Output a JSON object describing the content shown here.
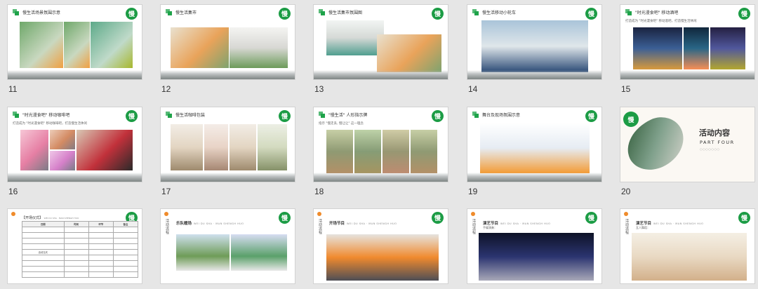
{
  "slides": [
    {
      "number": "11",
      "title": "慢生活场景氛围示意",
      "logo": "慢"
    },
    {
      "number": "12",
      "title": "慢生活集市",
      "logo": "慢"
    },
    {
      "number": "13",
      "title": "慢生活集市氛围图",
      "logo": "慢"
    },
    {
      "number": "14",
      "title": "慢生活移动小轮车",
      "logo": "慢"
    },
    {
      "number": "15",
      "title": "\"时光漫食吧\" 移动酒吧",
      "subtitle": "打造成为 \"时光漫食吧\" 移动酒吧，打造慢生活休闲",
      "logo": "慢"
    },
    {
      "number": "16",
      "title": "\"时光漫食吧\" 移动咖啡吧",
      "subtitle": "打造成为 \"时光漫食吧\" 移动咖啡吧，打造慢生活休闲",
      "logo": "慢"
    },
    {
      "number": "17",
      "title": "慢生活咖啡包装",
      "logo": "慢"
    },
    {
      "number": "18",
      "title": "\"慢生活\" 人形指示牌",
      "subtitle": "指示 \"慢走丢, 慢让让\" 这一理念",
      "logo": "慢"
    },
    {
      "number": "19",
      "title": "舞台及现场氛围示意",
      "logo": "慢"
    },
    {
      "number": "20",
      "part_title": "活动内容",
      "part_label": "PART FOUR",
      "part_dots": "○○○○○○○",
      "logo": "慢"
    }
  ],
  "table_slide": {
    "title": "【开场仪式】",
    "title_en": "WEI DU SHA · MAN SHENGH HUO",
    "headers": [
      "日期",
      "时间",
      "环节",
      "备注"
    ],
    "rows": [
      [
        "",
        "",
        "",
        ""
      ],
      [
        "",
        "",
        "",
        ""
      ],
      [
        "",
        "",
        "",
        ""
      ],
      [
        "",
        "",
        "",
        ""
      ],
      [
        "活动当天",
        "",
        "",
        ""
      ],
      [
        "",
        "",
        "",
        ""
      ],
      [
        "",
        "",
        "",
        ""
      ],
      [
        "",
        "",
        "",
        ""
      ],
      [
        "",
        "",
        "",
        ""
      ]
    ],
    "logo": "慢"
  },
  "section_slides": [
    {
      "vertical": "活动流程",
      "title": "乐队暖场",
      "title_en": "WEI DU SHA · MAN SHENGH HUO",
      "subtitle": "",
      "logo": "慢"
    },
    {
      "vertical": "活动流程",
      "title": "开场节目",
      "title_en": "WEI DU SHA · MAN SHENGH HUO",
      "subtitle": "",
      "logo": "慢"
    },
    {
      "vertical": "活动流程",
      "title": "演艺节目",
      "title_en": "WEI DU SHA · MAN SHENGH HUO",
      "subtitle": "手碟演奏：",
      "logo": "慢"
    },
    {
      "vertical": "活动流程",
      "title": "演艺节目",
      "title_en": "WEI DU SHA · MAN SHENGH HUO",
      "subtitle": "瓦人舞蹈：",
      "logo": "慢"
    }
  ]
}
